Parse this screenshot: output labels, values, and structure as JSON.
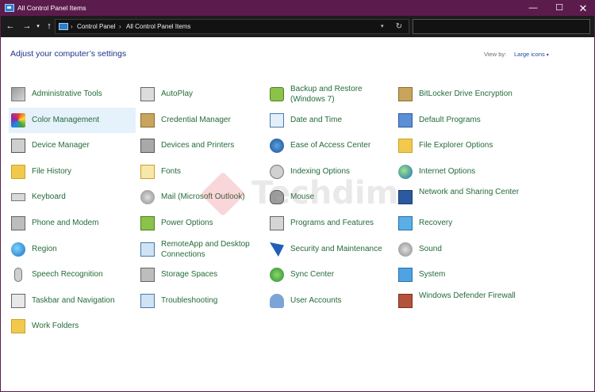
{
  "window": {
    "title": "All Control Panel Items"
  },
  "nav": {
    "back": "←",
    "forward": "→",
    "recent": "▾",
    "up": "↑",
    "breadcrumbs": [
      "Control Panel",
      "All Control Panel Items"
    ],
    "separator": "›",
    "refresh": "↻",
    "address_dropdown": "▾",
    "search_placeholder": ""
  },
  "titlebar": {
    "minimize": "—",
    "maximize": "☐",
    "close": "✕"
  },
  "content": {
    "heading": "Adjust your computer’s settings",
    "view_by_label": "View by:",
    "view_by_value": "Large icons",
    "view_by_caret": "▾"
  },
  "columns": [
    [
      {
        "label": "Administrative Tools",
        "icon": "administrative-tools-icon"
      },
      {
        "label": "Color Management",
        "icon": "color-management-icon",
        "selected": true
      },
      {
        "label": "Device Manager",
        "icon": "device-manager-icon"
      },
      {
        "label": "File History",
        "icon": "file-history-icon"
      },
      {
        "label": "Keyboard",
        "icon": "keyboard-icon"
      },
      {
        "label": "Phone and Modem",
        "icon": "phone-modem-icon"
      },
      {
        "label": "Region",
        "icon": "region-icon"
      },
      {
        "label": "Speech Recognition",
        "icon": "microphone-icon"
      },
      {
        "label": "Taskbar and Navigation",
        "icon": "taskbar-icon"
      },
      {
        "label": "Work Folders",
        "icon": "work-folders-icon"
      }
    ],
    [
      {
        "label": "AutoPlay",
        "icon": "autoplay-icon"
      },
      {
        "label": "Credential Manager",
        "icon": "credential-manager-icon"
      },
      {
        "label": "Devices and Printers",
        "icon": "printer-icon"
      },
      {
        "label": "Fonts",
        "icon": "fonts-icon"
      },
      {
        "label": "Mail (Microsoft Outlook)",
        "icon": "mail-icon"
      },
      {
        "label": "Power Options",
        "icon": "power-options-icon"
      },
      {
        "label": "RemoteApp and Desktop Connections",
        "icon": "remoteapp-icon"
      },
      {
        "label": "Storage Spaces",
        "icon": "storage-spaces-icon"
      },
      {
        "label": "Troubleshooting",
        "icon": "troubleshooting-icon"
      }
    ],
    [
      {
        "label": "Backup and Restore (Windows 7)",
        "icon": "backup-restore-icon"
      },
      {
        "label": "Date and Time",
        "icon": "date-time-icon"
      },
      {
        "label": "Ease of Access Center",
        "icon": "ease-of-access-icon"
      },
      {
        "label": "Indexing Options",
        "icon": "indexing-options-icon"
      },
      {
        "label": "Mouse",
        "icon": "mouse-icon"
      },
      {
        "label": "Programs and Features",
        "icon": "programs-features-icon"
      },
      {
        "label": "Security and Maintenance",
        "icon": "security-flag-icon"
      },
      {
        "label": "Sync Center",
        "icon": "sync-center-icon"
      },
      {
        "label": "User Accounts",
        "icon": "user-accounts-icon"
      }
    ],
    [
      {
        "label": "BitLocker Drive Encryption",
        "icon": "bitlocker-icon"
      },
      {
        "label": "Default Programs",
        "icon": "default-programs-icon"
      },
      {
        "label": "File Explorer Options",
        "icon": "file-explorer-options-icon"
      },
      {
        "label": "Internet Options",
        "icon": "internet-options-icon"
      },
      {
        "label": "Network and Sharing Center",
        "icon": "network-sharing-icon"
      },
      {
        "label": "Recovery",
        "icon": "recovery-icon"
      },
      {
        "label": "Sound",
        "icon": "sound-icon"
      },
      {
        "label": "System",
        "icon": "system-icon"
      },
      {
        "label": "Windows Defender Firewall",
        "icon": "firewall-icon"
      }
    ]
  ],
  "watermark": {
    "text": "Techdim"
  },
  "colors": {
    "titlebar": "#5b1c4d",
    "link": "#246b3a",
    "heading": "#1e3287",
    "selected": "#e5f1fb"
  }
}
